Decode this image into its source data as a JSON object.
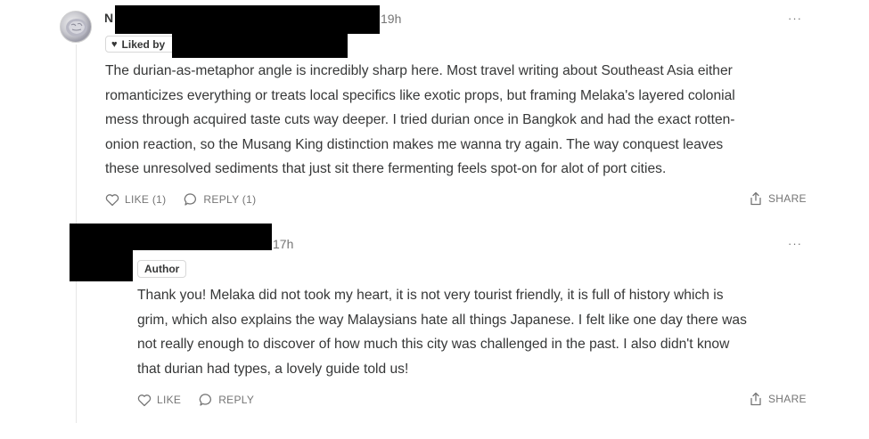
{
  "comments": [
    {
      "author_initial": "N",
      "timestamp": "19h",
      "liked_badge": "Liked by",
      "more_label": "···",
      "text_lines": [
        "The durian-as-metaphor angle is incredibly sharp here. Most travel writing about Southeast Asia either",
        "romanticizes everything or treats local specifics like exotic props, but framing Melaka's layered colonial",
        "mess through acquired taste cuts way deeper. I tried durian once in Bangkok and had the exact rotten-",
        "onion reaction, so the Musang King distinction makes me wanna try again. The way conquest leaves",
        "these unresolved sediments that just sit there fermenting feels spot-on for alot of port cities."
      ],
      "like_label": "LIKE (1)",
      "reply_label": "REPLY (1)",
      "share_label": "SHARE"
    },
    {
      "timestamp": "17h",
      "author_badge": "Author",
      "more_label": "···",
      "text_lines": [
        "Thank you! Melaka did not took my heart, it is not very tourist friendly, it is full of history which is",
        "grim, which also explains the way Malaysians hate all things Japanese. I felt like one day there was",
        "not really enough to discover of how much this city was challenged in the past. I also didn't know",
        "that durian had types, a lovely guide told us!"
      ],
      "like_label": "LIKE",
      "reply_label": "REPLY",
      "share_label": "SHARE"
    }
  ],
  "icons": {
    "like": "heart-outline-icon",
    "reply": "speech-bubble-icon",
    "share": "share-upload-icon",
    "more": "ellipsis-icon"
  },
  "colors": {
    "text": "#363737",
    "muted": "#757575",
    "redaction": "#000000"
  }
}
